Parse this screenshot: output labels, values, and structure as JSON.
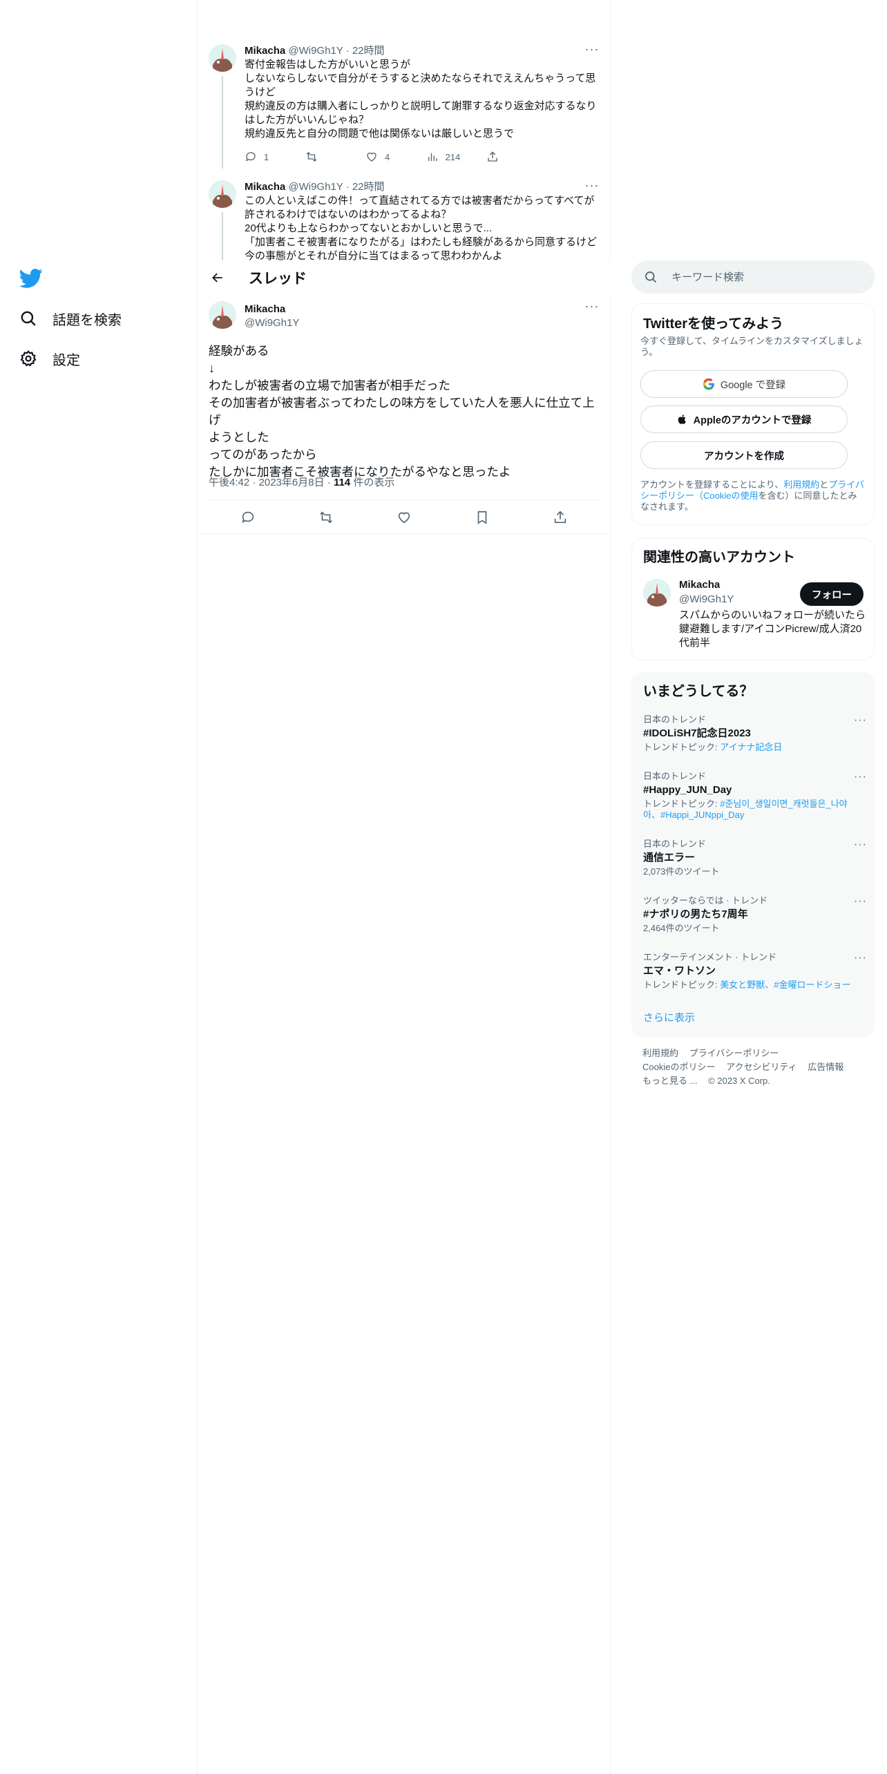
{
  "nav": {
    "explore": "話題を検索",
    "settings": "設定"
  },
  "thread": {
    "title": "スレッド",
    "replies": [
      {
        "name": "Mikacha",
        "handle": "@Wi9Gh1Y",
        "time": "22時間",
        "lines": [
          "寄付金報告はした方がいいと思うが",
          "しないならしないで自分がそうすると決めたならそれでええんちゃうって思",
          "うけど",
          "規約違反の方は購入者にしっかりと説明して謝罪するなり返金対応するなり",
          "はした方がいいんじゃね？",
          "規約違反先と自分の問題で他は関係ないは厳しいと思うで"
        ],
        "stats": {
          "replies": "1",
          "retweets": "",
          "likes": "4",
          "views": "214"
        }
      },
      {
        "name": "Mikacha",
        "handle": "@Wi9Gh1Y",
        "time": "22時間",
        "lines": [
          "この人といえばこの件！って直結されてる方では被害者だからってすべてが",
          "許されるわけではないのはわかってるよね？",
          "20代よりも上ならわかってないとおかしいと思うで...",
          "「加害者こそ被害者になりたがる」はわたしも経験があるから同意するけど",
          "今の事態がとそれが自分に当てはまるって思わわかんよ"
        ]
      }
    ]
  },
  "focused": {
    "name": "Mikacha",
    "handle": "@Wi9Gh1Y",
    "lines": [
      "経験がある",
      "↓",
      "わたしが被害者の立場で加害者が相手だった",
      "その加害者が被害者ぶってわたしの味方をしていた人を悪人に仕立て上げ",
      "ようとした",
      "ってのがあったから",
      "たしかに加害者こそ被害者になりたがるやなと思ったよ"
    ],
    "time": "午後4:42",
    "date": "2023年6月8日",
    "views_count": "114",
    "views_label": "件の表示"
  },
  "search": {
    "placeholder": "キーワード検索"
  },
  "signup": {
    "title": "Twitterを使ってみよう",
    "desc": "今すぐ登録して、タイムラインをカスタマイズしましょう。",
    "google": "Google で登録",
    "apple": "Appleのアカウントで登録",
    "create": "アカウントを作成",
    "terms_pre": "アカウントを登録することにより、",
    "terms_link1": "利用規約",
    "terms_and": "と",
    "terms_link2": "プライバシーポリシー（Cookieの使用",
    "terms_post": "を含む）に同意したとみなされます。"
  },
  "related": {
    "title": "関連性の高いアカウント",
    "name": "Mikacha",
    "handle": "@Wi9Gh1Y",
    "follow": "フォロー",
    "bio": "スパムからのいいねフォローが続いたら鍵避難します/アイコンPicrew/成人済20代前半"
  },
  "trends": {
    "title": "いまどうしてる？",
    "items": [
      {
        "context": "日本のトレンド",
        "name": "#IDOLiSH7記念日2023",
        "topic_prefix": "トレンドトピック: ",
        "topic": "アイナナ記念日"
      },
      {
        "context": "日本のトレンド",
        "name": "#Happy_JUN_Day",
        "topic_prefix": "トレンドトピック: ",
        "topic": "#준님이_생일이면_캐럿들은_나야아、#Happi_JUNppi_Day"
      },
      {
        "context": "日本のトレンド",
        "name": "通信エラー",
        "topic_prefix": "",
        "topic": "2,073件のツイート"
      },
      {
        "context": "ツイッターならでは · トレンド",
        "name": "#ナポリの男たち7周年",
        "topic_prefix": "",
        "topic": "2,464件のツイート"
      },
      {
        "context": "エンターテインメント · トレンド",
        "name": "エマ・ワトソン",
        "topic_prefix": "トレンドトピック: ",
        "topic": "美女と野獣、#金曜ロードショー"
      }
    ],
    "show_more": "さらに表示"
  },
  "footer": {
    "terms": "利用規約",
    "privacy": "プライバシーポリシー",
    "cookie": "Cookieのポリシー",
    "accessibility": "アクセシビリティ",
    "ads": "広告情報",
    "more": "もっと見る ...",
    "copyright": "© 2023 X Corp."
  },
  "colors": {
    "accent": "#1d9bf0",
    "text": "#0f1419",
    "muted": "#536471"
  }
}
